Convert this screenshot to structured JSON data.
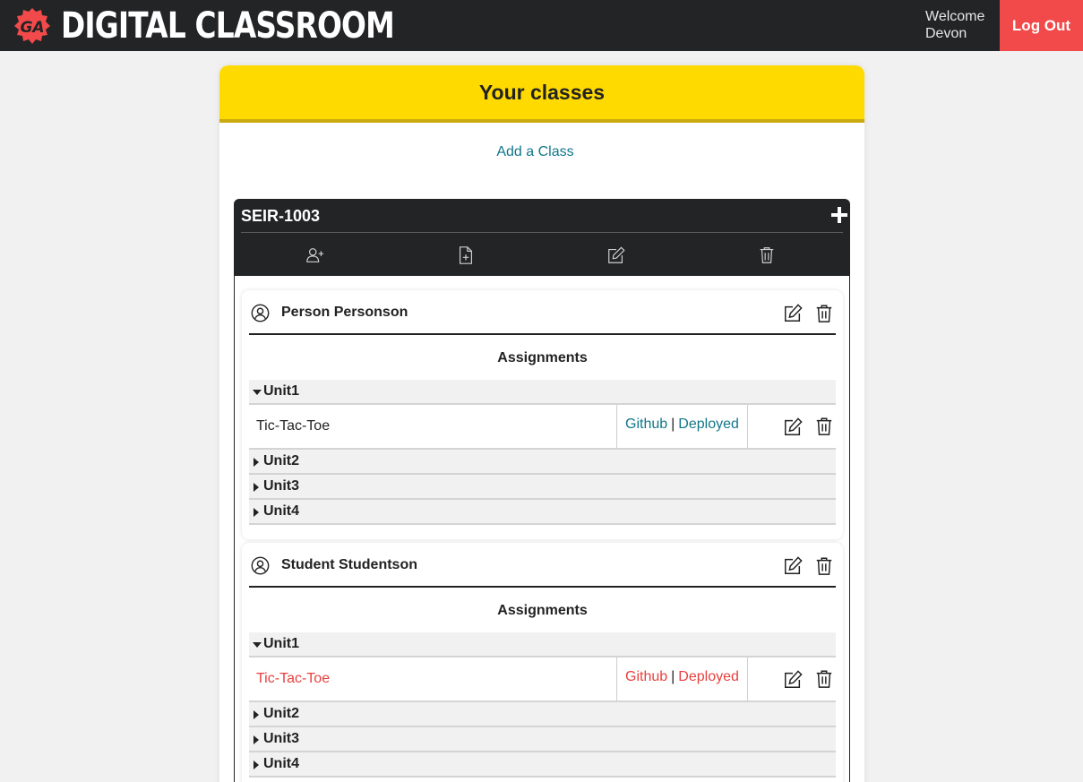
{
  "header": {
    "logo_text": "GA",
    "app_title": "DIGITAL CLASSROOM",
    "welcome_line1": "Welcome",
    "welcome_line2": "Devon",
    "logout_label": "Log Out"
  },
  "panel": {
    "title": "Your classes",
    "add_class_label": "Add a Class"
  },
  "class": {
    "name": "SEIR-1003",
    "toolbar": [
      "add-student-icon",
      "add-assignment-icon",
      "edit-class-icon",
      "delete-class-icon"
    ]
  },
  "students": [
    {
      "name": "Person Personson",
      "assignments_title": "Assignments",
      "units": [
        {
          "label": "Unit1",
          "expanded": true,
          "assignments": [
            {
              "name": "Tic-Tac-Toe",
              "github_label": "Github",
              "separator": "|",
              "deployed_label": "Deployed",
              "status_color": "#11778a"
            }
          ]
        },
        {
          "label": "Unit2",
          "expanded": false
        },
        {
          "label": "Unit3",
          "expanded": false
        },
        {
          "label": "Unit4",
          "expanded": false
        }
      ]
    },
    {
      "name": "Student Studentson",
      "assignments_title": "Assignments",
      "units": [
        {
          "label": "Unit1",
          "expanded": true,
          "assignments": [
            {
              "name": "Tic-Tac-Toe",
              "github_label": "Github",
              "separator": "|",
              "deployed_label": "Deployed",
              "status_color": "#e8403f"
            }
          ]
        },
        {
          "label": "Unit2",
          "expanded": false
        },
        {
          "label": "Unit3",
          "expanded": false
        },
        {
          "label": "Unit4",
          "expanded": false
        }
      ]
    }
  ],
  "colors": {
    "navbar": "#222426",
    "accent_yellow": "#ffda00",
    "logout_red": "#f24a4a",
    "link_teal": "#11778a",
    "late_red": "#e8403f"
  }
}
